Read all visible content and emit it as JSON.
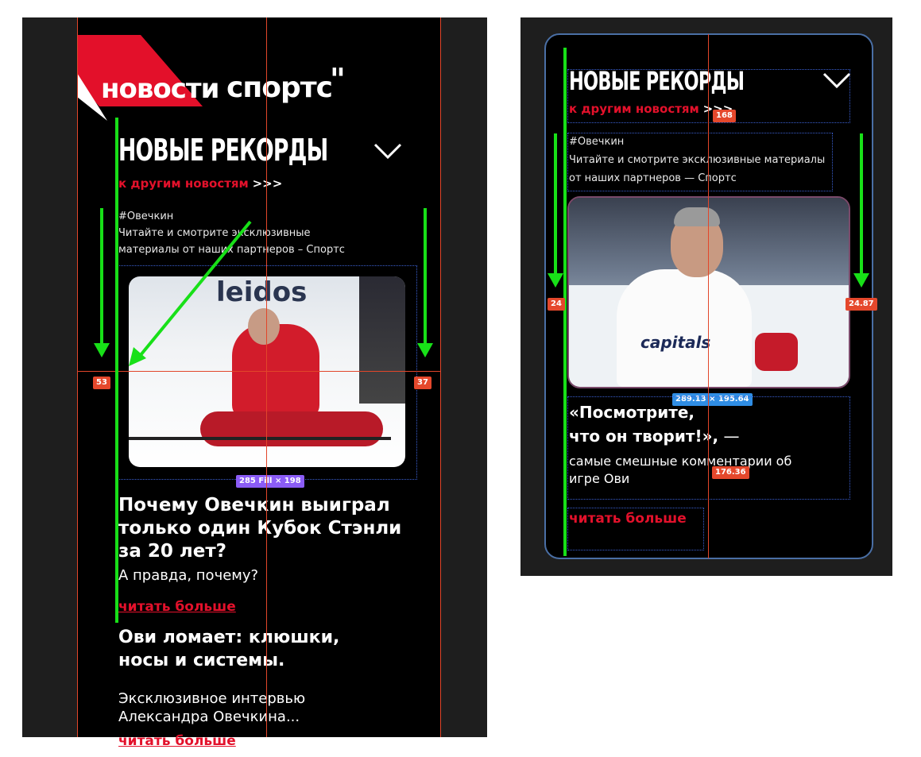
{
  "left": {
    "logo": {
      "part1": "новости",
      "part2": "спортс",
      "mark": "\""
    },
    "title": "НОВЫЕ РЕКОРДЫ",
    "back_link": {
      "text": "к другим новостям",
      "arrows": ">>>"
    },
    "tag": "#Овечкин",
    "intro": "Читайте и смотрите эксклюзивные материалы от наших партнеров – Спортс",
    "image_dim": "285 Fill × 198",
    "article1": {
      "title": "Почему Овечкин выиграл только один Кубок Стэнли за 20 лет?",
      "subtitle": "А правда, почему?",
      "more": "читать больше"
    },
    "article2": {
      "title": "Ови ломает: клюшки, носы и системы.",
      "subtitle": "Эксклюзивное интервью Александра Овечкина...",
      "more": "читать больше"
    },
    "measures": {
      "left": "53",
      "right": "37"
    }
  },
  "right": {
    "title": "НОВЫЕ РЕКОРДЫ",
    "back_link": {
      "text": "к другим новостям",
      "arrows": ">>>"
    },
    "tag": "#Овечкин",
    "intro": "Читайте и смотрите эксклюзивные материалы от наших партнеров — Спортс",
    "image_dim": "289.13 × 195.64",
    "quote": {
      "title_line1": "«Посмотрите,",
      "title_line2": "что он творит!»,",
      "dash": "—",
      "desc": "самые смешные комментарии об игре Ови"
    },
    "more": "читать больше",
    "measures": {
      "top": "168",
      "left": "24",
      "right": "24.87",
      "bottom": "176.36"
    }
  },
  "icons": [
    "chevron-down-icon"
  ],
  "colors": {
    "accent": "#e3112b",
    "guide": "#e2462a",
    "arrow": "#18e018",
    "canvas": "#1e1e1e"
  }
}
